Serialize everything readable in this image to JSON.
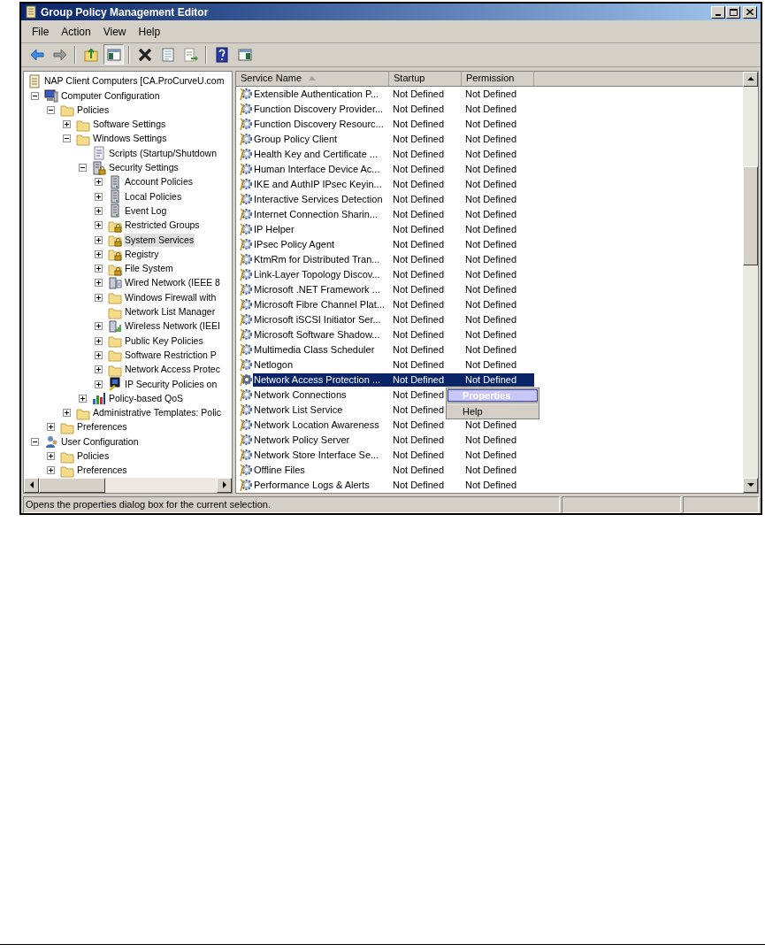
{
  "window": {
    "title": "Group Policy Management Editor"
  },
  "menu": [
    "File",
    "Action",
    "View",
    "Help"
  ],
  "toolbar": [
    {
      "kind": "back",
      "pressed": false
    },
    {
      "kind": "forward",
      "pressed": false
    },
    {
      "kind": "sep"
    },
    {
      "kind": "up",
      "pressed": false
    },
    {
      "kind": "tree",
      "pressed": true
    },
    {
      "kind": "sep"
    },
    {
      "kind": "delete",
      "pressed": false
    },
    {
      "kind": "properties",
      "pressed": false
    },
    {
      "kind": "export",
      "pressed": false
    },
    {
      "kind": "sep"
    },
    {
      "kind": "help",
      "pressed": false
    },
    {
      "kind": "pane",
      "pressed": false
    }
  ],
  "tree": [
    {
      "label": "NAP Client Computers [CA.ProCurveU.com",
      "kind": "document",
      "selected": false,
      "children": [
        {
          "label": "Computer Configuration",
          "kind": "computer",
          "expanded": true,
          "selected": false,
          "children": [
            {
              "label": "Policies",
              "kind": "folder",
              "expanded": true,
              "selected": false,
              "children": [
                {
                  "label": "Software Settings",
                  "kind": "folder",
                  "expanded": false,
                  "selected": false
                },
                {
                  "label": "Windows Settings",
                  "kind": "folder",
                  "expanded": true,
                  "selected": false,
                  "children": [
                    {
                      "label": "Scripts (Startup/Shutdown",
                      "kind": "script",
                      "selected": false
                    },
                    {
                      "label": "Security Settings",
                      "kind": "lockserver",
                      "expanded": true,
                      "selected": false,
                      "children": [
                        {
                          "label": "Account Policies",
                          "kind": "server",
                          "expanded": false,
                          "selected": false
                        },
                        {
                          "label": "Local Policies",
                          "kind": "server",
                          "expanded": false,
                          "selected": false
                        },
                        {
                          "label": "Event Log",
                          "kind": "server",
                          "expanded": false,
                          "selected": false
                        },
                        {
                          "label": "Restricted Groups",
                          "kind": "lockfolder",
                          "expanded": false,
                          "selected": false
                        },
                        {
                          "label": "System Services",
                          "kind": "lockfolder",
                          "expanded": false,
                          "selected": true
                        },
                        {
                          "label": "Registry",
                          "kind": "lockfolder",
                          "expanded": false,
                          "selected": false
                        },
                        {
                          "label": "File System",
                          "kind": "lockfolder",
                          "expanded": false,
                          "selected": false
                        },
                        {
                          "label": "Wired Network (IEEE 8",
                          "kind": "network",
                          "expanded": false,
                          "selected": false
                        },
                        {
                          "label": "Windows Firewall with",
                          "kind": "folder",
                          "expanded": false,
                          "selected": false
                        },
                        {
                          "label": "Network List Manager",
                          "kind": "folder",
                          "selected": false
                        },
                        {
                          "label": "Wireless Network (IEEI",
                          "kind": "wireless",
                          "expanded": false,
                          "selected": false
                        },
                        {
                          "label": "Public Key Policies",
                          "kind": "folder",
                          "expanded": false,
                          "selected": false
                        },
                        {
                          "label": "Software Restriction P",
                          "kind": "folder",
                          "expanded": false,
                          "selected": false
                        },
                        {
                          "label": "Network Access Protec",
                          "kind": "folder",
                          "expanded": false,
                          "selected": false
                        },
                        {
                          "label": "IP Security Policies on",
                          "kind": "ipsec",
                          "expanded": false,
                          "selected": false
                        }
                      ]
                    },
                    {
                      "label": "Policy-based QoS",
                      "kind": "chart",
                      "expanded": false,
                      "selected": false
                    }
                  ]
                },
                {
                  "label": "Administrative Templates: Polic",
                  "kind": "folder",
                  "expanded": false,
                  "selected": false
                }
              ]
            },
            {
              "label": "Preferences",
              "kind": "folder",
              "expanded": false,
              "selected": false
            }
          ]
        },
        {
          "label": "User Configuration",
          "kind": "user",
          "expanded": true,
          "selected": false,
          "children": [
            {
              "label": "Policies",
              "kind": "folder",
              "expanded": false,
              "selected": false
            },
            {
              "label": "Preferences",
              "kind": "folder",
              "expanded": false,
              "selected": false
            }
          ]
        }
      ]
    }
  ],
  "columns": [
    {
      "label": "Service Name",
      "sorted": true
    },
    {
      "label": "Startup",
      "sorted": false
    },
    {
      "label": "Permission",
      "sorted": false
    }
  ],
  "services": [
    {
      "name": "Extensible Authentication P...",
      "startup": "Not Defined",
      "permission": "Not Defined",
      "selected": false
    },
    {
      "name": "Function Discovery Provider...",
      "startup": "Not Defined",
      "permission": "Not Defined",
      "selected": false
    },
    {
      "name": "Function Discovery Resourc...",
      "startup": "Not Defined",
      "permission": "Not Defined",
      "selected": false
    },
    {
      "name": "Group Policy Client",
      "startup": "Not Defined",
      "permission": "Not Defined",
      "selected": false
    },
    {
      "name": "Health Key and Certificate ...",
      "startup": "Not Defined",
      "permission": "Not Defined",
      "selected": false
    },
    {
      "name": "Human Interface Device Ac...",
      "startup": "Not Defined",
      "permission": "Not Defined",
      "selected": false
    },
    {
      "name": "IKE and AuthIP IPsec Keyin...",
      "startup": "Not Defined",
      "permission": "Not Defined",
      "selected": false
    },
    {
      "name": "Interactive Services Detection",
      "startup": "Not Defined",
      "permission": "Not Defined",
      "selected": false
    },
    {
      "name": "Internet Connection Sharin...",
      "startup": "Not Defined",
      "permission": "Not Defined",
      "selected": false
    },
    {
      "name": "IP Helper",
      "startup": "Not Defined",
      "permission": "Not Defined",
      "selected": false
    },
    {
      "name": "IPsec Policy Agent",
      "startup": "Not Defined",
      "permission": "Not Defined",
      "selected": false
    },
    {
      "name": "KtmRm for Distributed Tran...",
      "startup": "Not Defined",
      "permission": "Not Defined",
      "selected": false
    },
    {
      "name": "Link-Layer Topology Discov...",
      "startup": "Not Defined",
      "permission": "Not Defined",
      "selected": false
    },
    {
      "name": "Microsoft .NET Framework ...",
      "startup": "Not Defined",
      "permission": "Not Defined",
      "selected": false
    },
    {
      "name": "Microsoft Fibre Channel Plat...",
      "startup": "Not Defined",
      "permission": "Not Defined",
      "selected": false
    },
    {
      "name": "Microsoft iSCSI Initiator Ser...",
      "startup": "Not Defined",
      "permission": "Not Defined",
      "selected": false
    },
    {
      "name": "Microsoft Software Shadow...",
      "startup": "Not Defined",
      "permission": "Not Defined",
      "selected": false
    },
    {
      "name": "Multimedia Class Scheduler",
      "startup": "Not Defined",
      "permission": "Not Defined",
      "selected": false
    },
    {
      "name": "Netlogon",
      "startup": "Not Defined",
      "permission": "Not Defined",
      "selected": false
    },
    {
      "name": "Network Access Protection ...",
      "startup": "Not Defined",
      "permission": "Not Defined",
      "selected": true
    },
    {
      "name": "Network Connections",
      "startup": "Not Defined",
      "selected": false
    },
    {
      "name": "Network List Service",
      "startup": "Not Defined",
      "selected": false
    },
    {
      "name": "Network Location Awareness",
      "startup": "Not Defined",
      "permission": "Not Defined",
      "selected": false
    },
    {
      "name": "Network Policy Server",
      "startup": "Not Defined",
      "permission": "Not Defined",
      "selected": false
    },
    {
      "name": "Network Store Interface Se...",
      "startup": "Not Defined",
      "permission": "Not Defined",
      "selected": false
    },
    {
      "name": "Offline Files",
      "startup": "Not Defined",
      "permission": "Not Defined",
      "selected": false
    },
    {
      "name": "Performance Logs & Alerts",
      "startup": "Not Defined",
      "permission": "Not Defined",
      "selected": false
    }
  ],
  "context_menu": [
    {
      "kind": "item",
      "label": "Properties",
      "selected": true
    },
    {
      "kind": "separator"
    },
    {
      "kind": "item",
      "label": "Help",
      "selected": false
    }
  ],
  "status_bar": {
    "text": "Opens the properties dialog box for the current selection."
  }
}
